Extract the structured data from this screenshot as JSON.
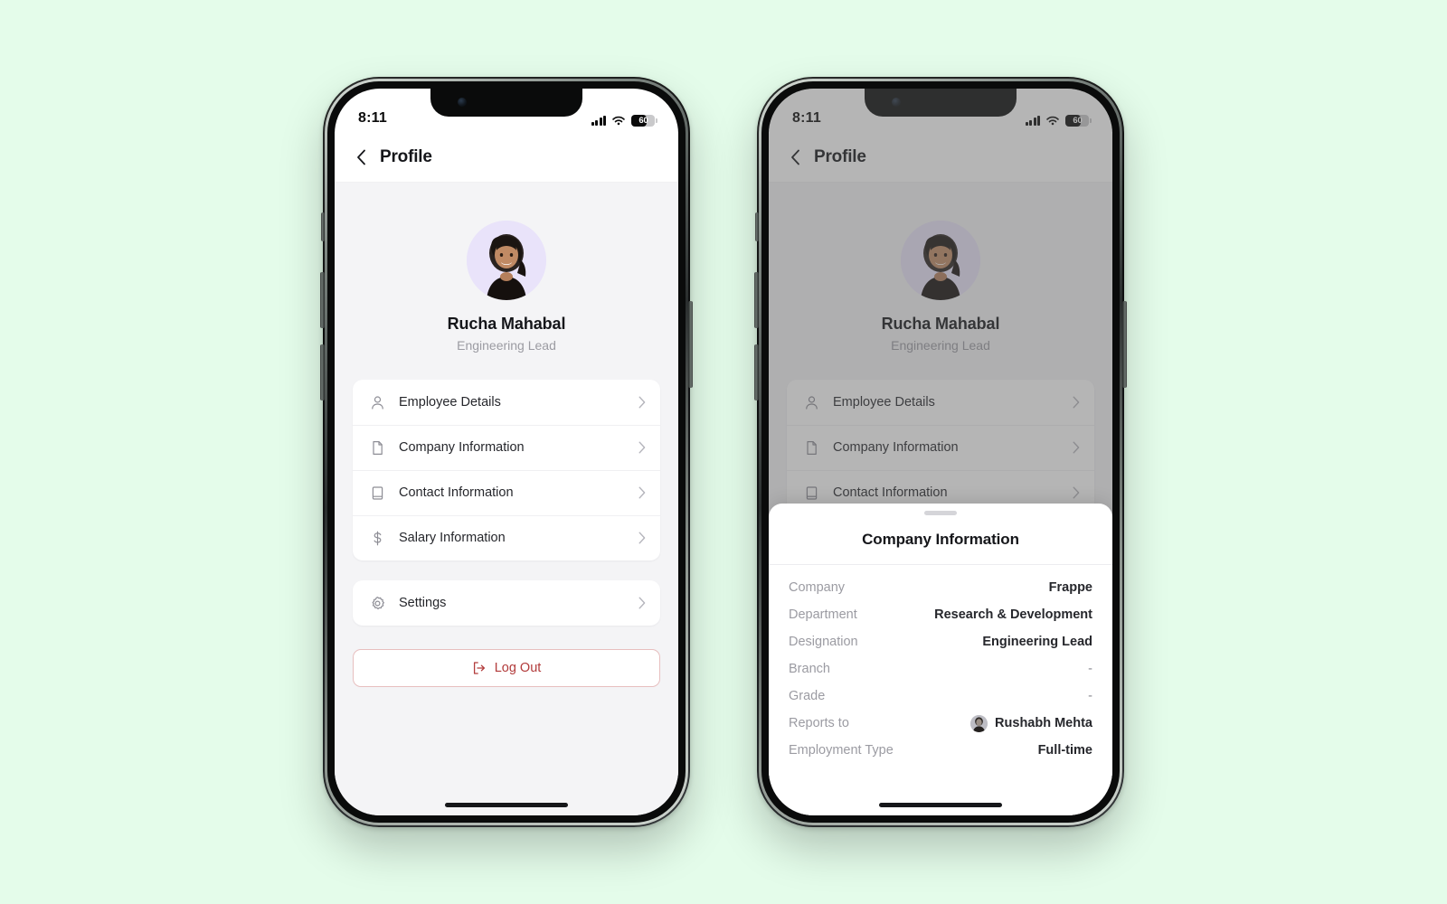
{
  "canvas": {
    "background": "#e4fcea"
  },
  "status_bar": {
    "time": "8:11",
    "signal_icon": "cellular-bars-icon",
    "wifi_icon": "wifi-icon",
    "battery_level": "60",
    "battery_icon": "battery-icon"
  },
  "nav": {
    "back_icon": "chevron-left-icon",
    "title": "Profile"
  },
  "profile": {
    "avatar_icon": "user-avatar",
    "name": "Rucha Mahabal",
    "role": "Engineering Lead"
  },
  "menu_primary": [
    {
      "icon": "user-icon",
      "label": "Employee Details",
      "chevron": "chevron-right-icon"
    },
    {
      "icon": "file-icon",
      "label": "Company Information",
      "chevron": "chevron-right-icon"
    },
    {
      "icon": "book-icon",
      "label": "Contact Information",
      "chevron": "chevron-right-icon"
    },
    {
      "icon": "dollar-icon",
      "label": "Salary Information",
      "chevron": "chevron-right-icon"
    }
  ],
  "menu_secondary": [
    {
      "icon": "gear-icon",
      "label": "Settings",
      "chevron": "chevron-right-icon"
    }
  ],
  "logout": {
    "label": "Log Out",
    "icon": "logout-icon",
    "color": "#b23b3b",
    "border_color": "#e7bfbf"
  },
  "sheet": {
    "handle_icon": "drag-handle",
    "title": "Company Information",
    "rows": [
      {
        "key": "Company",
        "value": "Frappe",
        "muted": false,
        "avatar": false
      },
      {
        "key": "Department",
        "value": "Research & Development",
        "muted": false,
        "avatar": false
      },
      {
        "key": "Designation",
        "value": "Engineering Lead",
        "muted": false,
        "avatar": false
      },
      {
        "key": "Branch",
        "value": "-",
        "muted": true,
        "avatar": false
      },
      {
        "key": "Grade",
        "value": "-",
        "muted": true,
        "avatar": false
      },
      {
        "key": "Reports to",
        "value": "Rushabh Mehta",
        "muted": false,
        "avatar": true
      },
      {
        "key": "Employment Type",
        "value": "Full-time",
        "muted": false,
        "avatar": false
      }
    ]
  }
}
